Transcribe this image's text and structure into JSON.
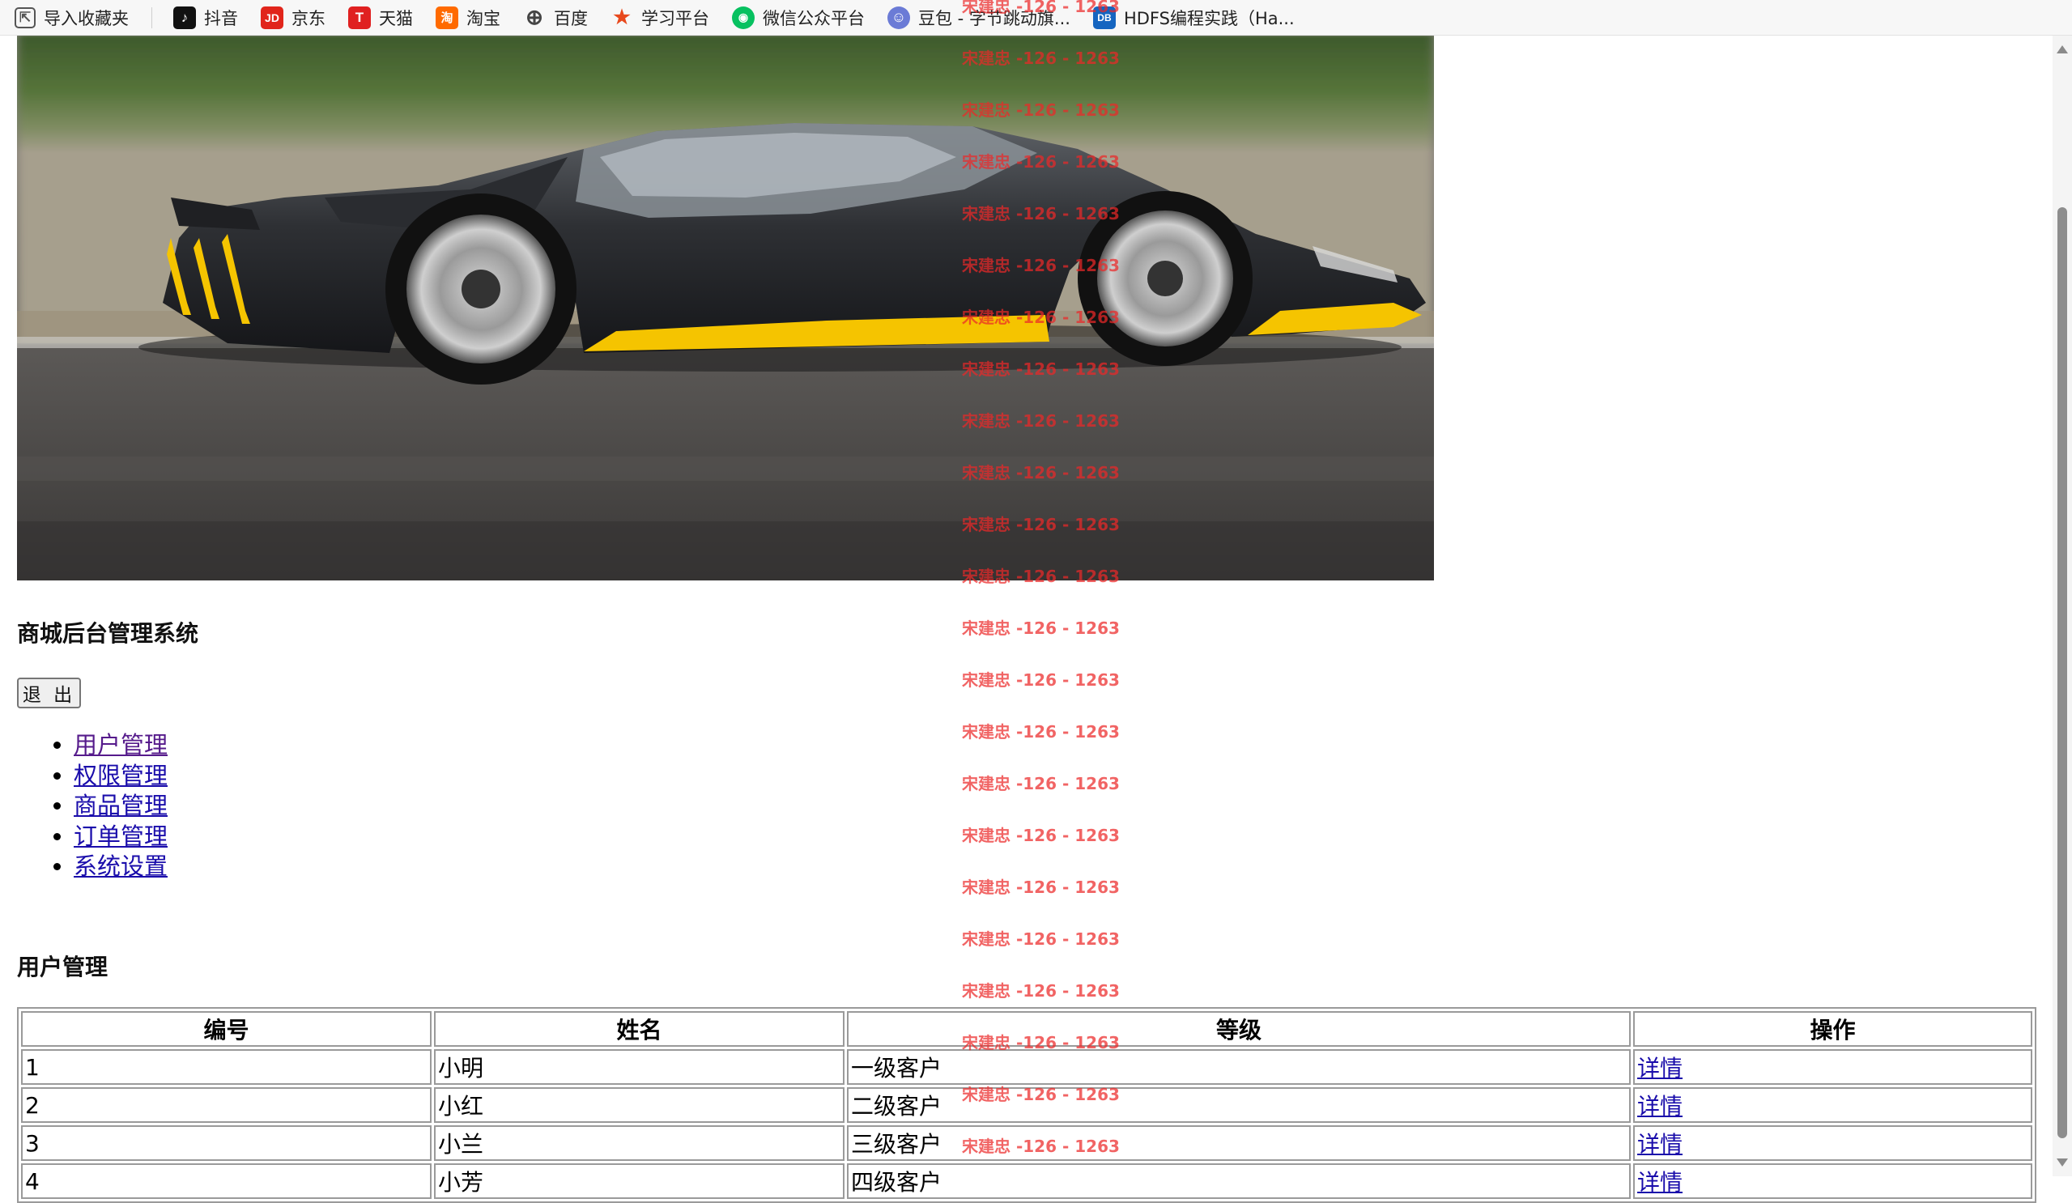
{
  "bookmarks": [
    {
      "label": "导入收藏夹",
      "icon": "import-icon",
      "color": "#555555",
      "glyph": "⇱"
    },
    {
      "label": "抖音",
      "icon": "douyin-icon",
      "color": "#111111",
      "glyph": "♪"
    },
    {
      "label": "京东",
      "icon": "jd-icon",
      "color": "#e1251b",
      "glyph": "JD"
    },
    {
      "label": "天猫",
      "icon": "tmall-icon",
      "color": "#e02020",
      "glyph": "T"
    },
    {
      "label": "淘宝",
      "icon": "taobao-icon",
      "color": "#ff6a00",
      "glyph": "淘"
    },
    {
      "label": "百度",
      "icon": "globe-icon",
      "color": "#444444",
      "glyph": "⊕"
    },
    {
      "label": "学习平台",
      "icon": "study-icon",
      "color": "#e8491d",
      "glyph": "★"
    },
    {
      "label": "微信公众平台",
      "icon": "wechat-icon",
      "color": "#07c160",
      "glyph": "◉"
    },
    {
      "label": "豆包 - 字节跳动旗...",
      "icon": "doubao-icon",
      "color": "#6b7bd6",
      "glyph": "☺"
    },
    {
      "label": "HDFS编程实践（Ha...",
      "icon": "lab-icon",
      "color": "#1565c0",
      "glyph": "DB"
    }
  ],
  "header": {
    "title": "商城后台管理系统",
    "logout_label": "退 出"
  },
  "menu": [
    {
      "label": "用户管理"
    },
    {
      "label": "权限管理"
    },
    {
      "label": "商品管理"
    },
    {
      "label": "订单管理"
    },
    {
      "label": "系统设置"
    }
  ],
  "section": {
    "title": "用户管理"
  },
  "table": {
    "columns": [
      "编号",
      "姓名",
      "等级",
      "操作"
    ],
    "rows": [
      {
        "id": "1",
        "name": "小明",
        "level": "一级客户",
        "action": "详情"
      },
      {
        "id": "2",
        "name": "小红",
        "level": "二级客户",
        "action": "详情"
      },
      {
        "id": "3",
        "name": "小兰",
        "level": "三级客户",
        "action": "详情"
      },
      {
        "id": "4",
        "name": "小芳",
        "level": "四级客户",
        "action": "详情"
      }
    ]
  },
  "watermark": {
    "text": "宋建忠 -126 - 1263",
    "color": "#eb2828"
  },
  "colors": {
    "link": "#1a0dab",
    "visited_link": "#551a8b",
    "car_body": "#2b2d31",
    "car_accent": "#f5c400"
  }
}
